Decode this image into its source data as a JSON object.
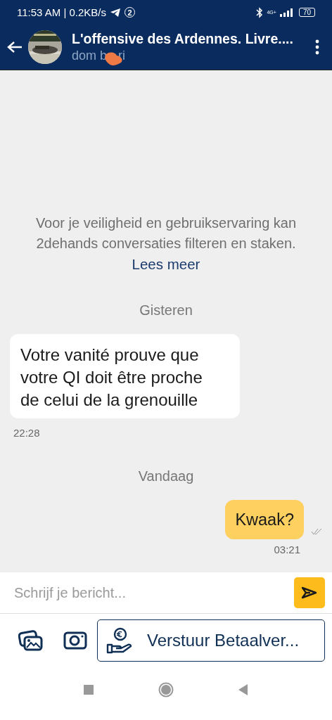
{
  "status_bar": {
    "time": "11:53 AM | 0.2KB/s",
    "notification_count": "2",
    "network": "4G+",
    "battery": "70"
  },
  "header": {
    "title": "L'offensive des Ardennes. Livre....",
    "subtitle_parts": [
      "dom b",
      "ri"
    ]
  },
  "messages": [
    {
      "kind": "notice",
      "text": "Voor je veiligheid en gebruikservaring kan 2dehands conversaties filteren en staken.",
      "link": "Lees meer"
    },
    {
      "kind": "date",
      "text": "Gisteren"
    },
    {
      "kind": "received",
      "text": "Votre vanité prouve que votre QI doit être proche de celui de la grenouille",
      "time": "22:28"
    },
    {
      "kind": "date",
      "text": "Vandaag"
    },
    {
      "kind": "sent",
      "text": "Kwaak?",
      "time": "03:21",
      "read": true
    }
  ],
  "composer": {
    "placeholder": "Schrijf je bericht..."
  },
  "actions": {
    "payment_button": "Verstuur Betaalver..."
  }
}
